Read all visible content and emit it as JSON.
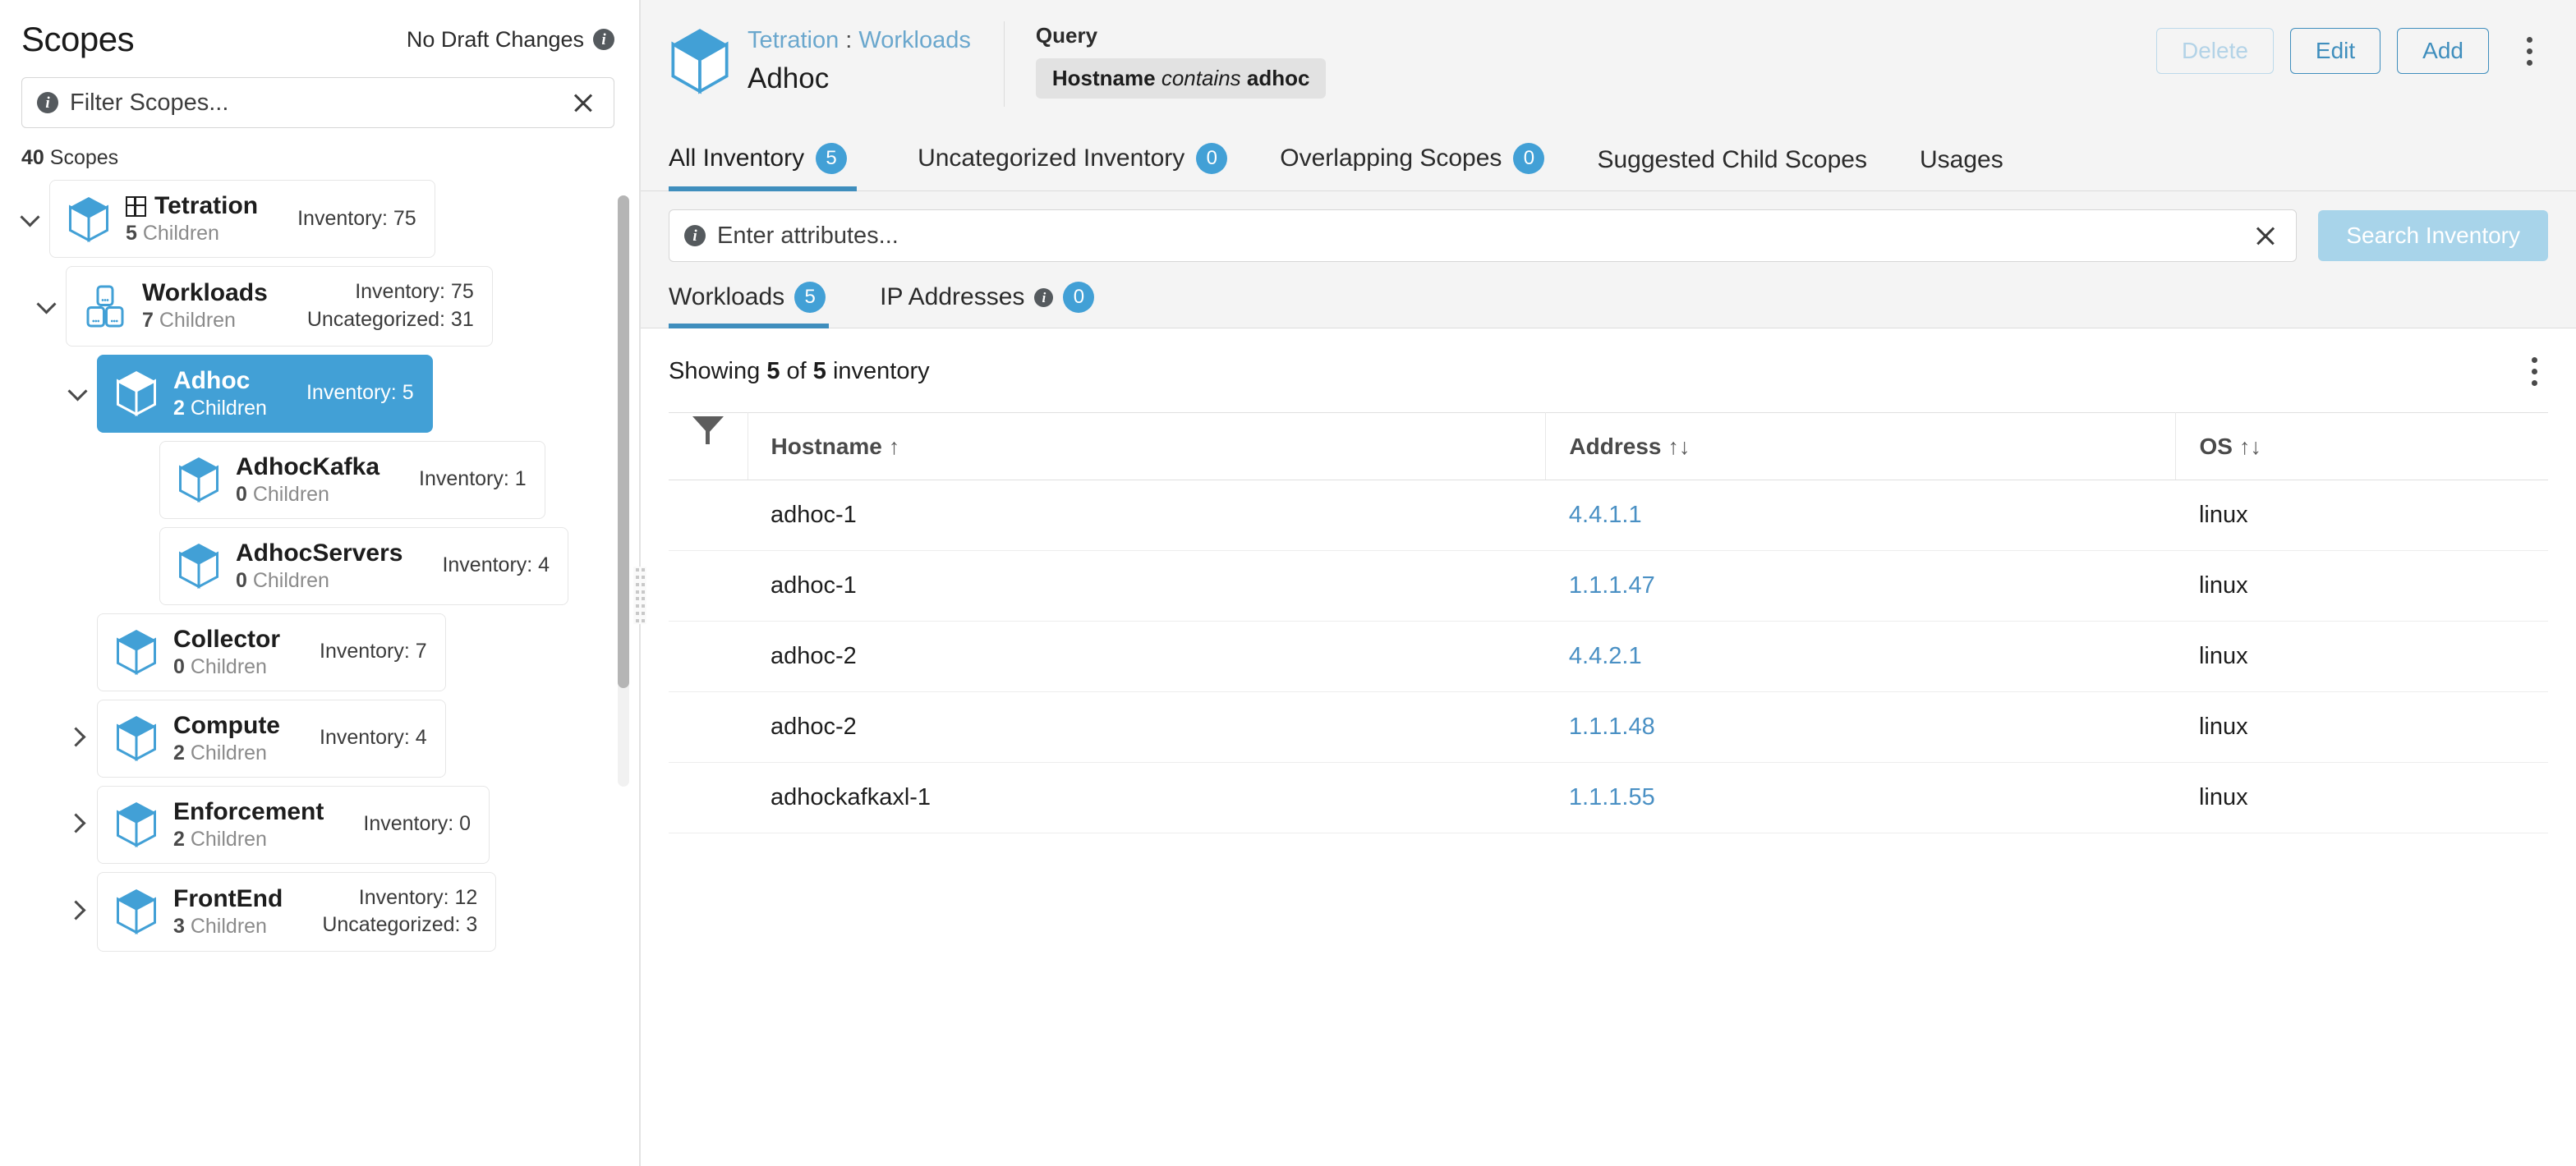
{
  "sidebar": {
    "title": "Scopes",
    "draft_status": "No Draft Changes",
    "filter_placeholder": "Filter Scopes...",
    "count_number": "40",
    "count_label": "Scopes",
    "tree": [
      {
        "name": "Tetration",
        "children": "5",
        "children_label": "Children",
        "inventory": "Inventory: 75",
        "uncategorized": "",
        "depth": 0,
        "caret": "down",
        "selected": false,
        "grid": true
      },
      {
        "name": "Workloads",
        "children": "7",
        "children_label": "Children",
        "inventory": "Inventory: 75",
        "uncategorized": "Uncategorized: 31",
        "depth": 1,
        "caret": "down",
        "selected": false,
        "grid": false
      },
      {
        "name": "Adhoc",
        "children": "2",
        "children_label": "Children",
        "inventory": "Inventory: 5",
        "uncategorized": "",
        "depth": 2,
        "caret": "down",
        "selected": true,
        "grid": false
      },
      {
        "name": "AdhocKafka",
        "children": "0",
        "children_label": "Children",
        "inventory": "Inventory: 1",
        "uncategorized": "",
        "depth": 3,
        "caret": "none",
        "selected": false,
        "grid": false
      },
      {
        "name": "AdhocServers",
        "children": "0",
        "children_label": "Children",
        "inventory": "Inventory: 4",
        "uncategorized": "",
        "depth": 3,
        "caret": "none",
        "selected": false,
        "grid": false
      },
      {
        "name": "Collector",
        "children": "0",
        "children_label": "Children",
        "inventory": "Inventory: 7",
        "uncategorized": "",
        "depth": 2,
        "caret": "none",
        "selected": false,
        "grid": false
      },
      {
        "name": "Compute",
        "children": "2",
        "children_label": "Children",
        "inventory": "Inventory: 4",
        "uncategorized": "",
        "depth": 2,
        "caret": "right",
        "selected": false,
        "grid": false
      },
      {
        "name": "Enforcement",
        "children": "2",
        "children_label": "Children",
        "inventory": "Inventory: 0",
        "uncategorized": "",
        "depth": 2,
        "caret": "right",
        "selected": false,
        "grid": false
      },
      {
        "name": "FrontEnd",
        "children": "3",
        "children_label": "Children",
        "inventory": "Inventory: 12",
        "uncategorized": "Uncategorized: 3",
        "depth": 2,
        "caret": "right",
        "selected": false,
        "grid": false
      }
    ]
  },
  "header": {
    "breadcrumb_root": "Tetration",
    "breadcrumb_sep": ":",
    "breadcrumb_parent": "Workloads",
    "scope_name": "Adhoc",
    "query_label": "Query",
    "query_field": "Hostname",
    "query_op": "contains",
    "query_value": "adhoc",
    "buttons": {
      "delete": "Delete",
      "edit": "Edit",
      "add": "Add"
    }
  },
  "tabs": [
    {
      "label": "All Inventory",
      "badge": "5",
      "active": true,
      "info": false
    },
    {
      "label": "Uncategorized Inventory",
      "badge": "0",
      "active": false,
      "info": false
    },
    {
      "label": "Overlapping Scopes",
      "badge": "0",
      "active": false,
      "info": false
    },
    {
      "label": "Suggested Child Scopes",
      "badge": "",
      "active": false,
      "info": false
    },
    {
      "label": "Usages",
      "badge": "",
      "active": false,
      "info": false
    }
  ],
  "search": {
    "placeholder": "Enter attributes...",
    "button_label": "Search Inventory"
  },
  "subtabs": [
    {
      "label": "Workloads",
      "badge": "5",
      "active": true,
      "info": false
    },
    {
      "label": "IP Addresses",
      "badge": "0",
      "active": false,
      "info": true
    }
  ],
  "results": {
    "showing_prefix": "Showing",
    "showing_count": "5",
    "showing_mid": "of",
    "showing_total": "5",
    "showing_suffix": "inventory"
  },
  "table": {
    "columns": [
      {
        "label": "Hostname",
        "sort": "↑"
      },
      {
        "label": "Address",
        "sort": "↑↓"
      },
      {
        "label": "OS",
        "sort": "↑↓"
      }
    ],
    "rows": [
      {
        "hostname": "adhoc-1",
        "address": "4.4.1.1",
        "os": "linux"
      },
      {
        "hostname": "adhoc-1",
        "address": "1.1.1.47",
        "os": "linux"
      },
      {
        "hostname": "adhoc-2",
        "address": "4.4.2.1",
        "os": "linux"
      },
      {
        "hostname": "adhoc-2",
        "address": "1.1.1.48",
        "os": "linux"
      },
      {
        "hostname": "adhockafkaxl-1",
        "address": "1.1.1.55",
        "os": "linux"
      }
    ]
  },
  "colors": {
    "accent": "#42a0d6",
    "link": "#4a90c4",
    "button_border": "#3f8ebd",
    "disabled": "#a8d4ea"
  }
}
